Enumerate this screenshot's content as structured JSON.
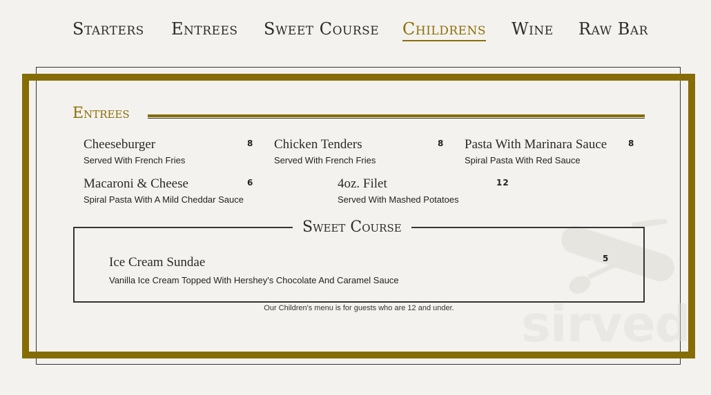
{
  "nav": {
    "items": [
      {
        "label": "Starters"
      },
      {
        "label": "Entrees"
      },
      {
        "label": "Sweet Course"
      },
      {
        "label": "Childrens"
      },
      {
        "label": "Wine"
      },
      {
        "label": "Raw Bar"
      }
    ],
    "active_index": 3
  },
  "entrees": {
    "title": "Entrees",
    "items": [
      {
        "name": "Cheeseburger",
        "desc": "Served With French Fries",
        "price": "8"
      },
      {
        "name": "Chicken Tenders",
        "desc": "Served With French Fries",
        "price": "8"
      },
      {
        "name": "Pasta With Marinara Sauce",
        "desc": "Spiral Pasta With Red Sauce",
        "price": "8"
      },
      {
        "name": "Macaroni & Cheese",
        "desc": "Spiral Pasta With A Mild Cheddar Sauce",
        "price": "6"
      },
      {
        "name": "4oz. Filet",
        "desc": "Served With Mashed Potatoes",
        "price": "12"
      }
    ]
  },
  "sweet_course": {
    "title": "Sweet Course",
    "items": [
      {
        "name": "Ice Cream Sundae",
        "desc": "Vanilla Ice Cream Topped With Hershey's Chocolate And Caramel Sauce",
        "price": "5"
      }
    ]
  },
  "footnote": "Our Children's menu is for guests who are 12 and under.",
  "watermark": {
    "text": "sirved",
    "icon": "utensils-knife-icon"
  },
  "colors": {
    "accent": "#8a6f08",
    "frame": "#856c05",
    "background": "#f4f2ee"
  }
}
